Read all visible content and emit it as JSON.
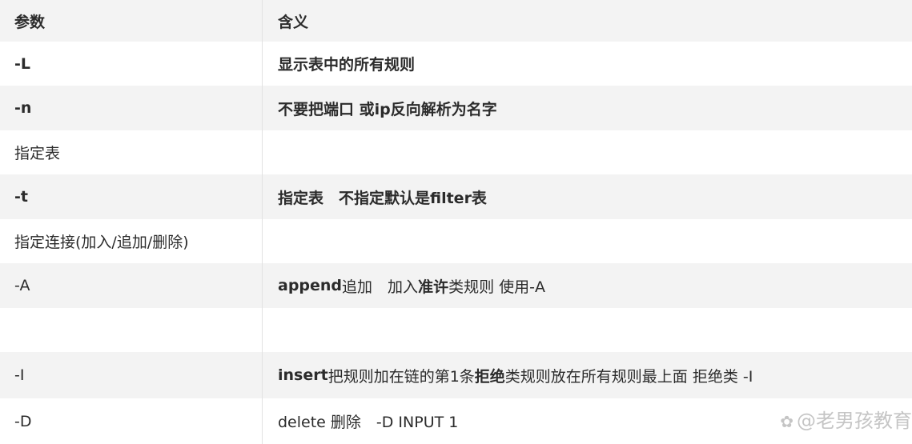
{
  "header": {
    "param": "参数",
    "meaning": "含义"
  },
  "rows": [
    {
      "param": "-L",
      "meaning": "显示表中的所有规则"
    },
    {
      "param": "-n",
      "meaning": "不要把端口 或ip反向解析为名字"
    },
    {
      "param": "指定表",
      "meaning": ""
    },
    {
      "param": "-t",
      "meaning": "指定表　不指定默认是filter表"
    },
    {
      "param": "指定连接(加入/追加/删除)",
      "meaning": ""
    },
    {
      "param": "-A",
      "meaning_parts": [
        "append",
        " 追加　加入",
        "准许",
        "类规则 使用-A"
      ]
    },
    {
      "param": "",
      "meaning": ""
    },
    {
      "param": "-I",
      "meaning_parts": [
        "insert",
        " 把规则加在链的第1条 ",
        "拒绝",
        "类规则放在所有规则最上面 拒绝类 -I"
      ]
    },
    {
      "param": "-D",
      "meaning": "delete 删除　-D INPUT  1"
    }
  ],
  "watermark": {
    "icon": "paw-icon",
    "text": "@老男孩教育"
  }
}
